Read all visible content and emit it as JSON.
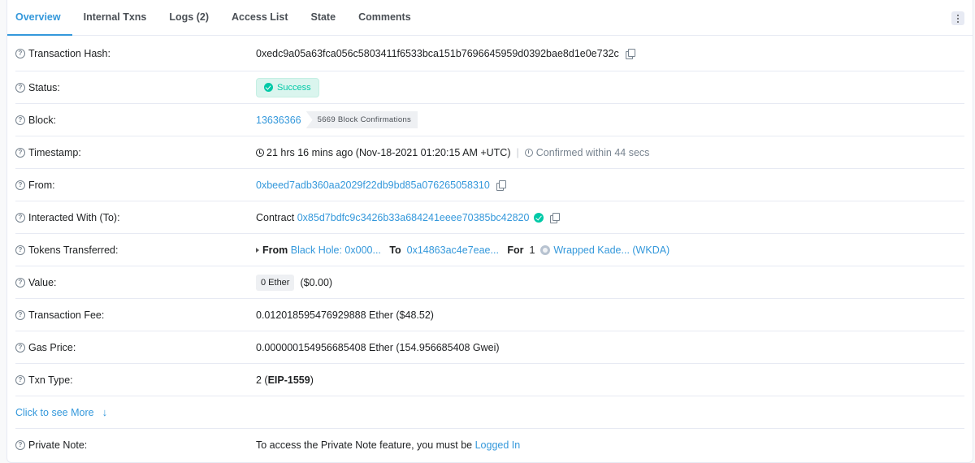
{
  "tabs": [
    {
      "label": "Overview",
      "active": true
    },
    {
      "label": "Internal Txns",
      "active": false
    },
    {
      "label": "Logs (2)",
      "active": false
    },
    {
      "label": "Access List",
      "active": false
    },
    {
      "label": "State",
      "active": false
    },
    {
      "label": "Comments",
      "active": false
    }
  ],
  "tx_hash": {
    "label": "Transaction Hash:",
    "value": "0xedc9a05a63fca056c5803411f6533bca151b7696645959d0392bae8d1e0e732c"
  },
  "status": {
    "label": "Status:",
    "value": "Success"
  },
  "block": {
    "label": "Block:",
    "number": "13636366",
    "confirmations": "5669 Block Confirmations"
  },
  "timestamp": {
    "label": "Timestamp:",
    "value": "21 hrs 16 mins ago (Nov-18-2021 01:20:15 AM +UTC)",
    "confirmed": "Confirmed within 44 secs"
  },
  "from": {
    "label": "From:",
    "value": "0xbeed7adb360aa2029f22db9bd85a076265058310"
  },
  "to": {
    "label": "Interacted With (To):",
    "prefix": "Contract",
    "address": "0x85d7bdfc9c3426b33a684241eeee70385bc42820"
  },
  "tokens": {
    "label": "Tokens Transferred:",
    "from_label": "From",
    "from_value": "Black Hole: 0x000...",
    "to_label": "To",
    "to_value": "0x14863ac4e7eae...",
    "for_label": "For",
    "amount": "1",
    "token": "Wrapped Kade... (WKDA)"
  },
  "value": {
    "label": "Value:",
    "amount": "0 Ether",
    "usd": "($0.00)"
  },
  "fee": {
    "label": "Transaction Fee:",
    "value": "0.012018595476929888 Ether ($48.52)"
  },
  "gas_price": {
    "label": "Gas Price:",
    "value": "0.000000154956685408 Ether (154.956685408 Gwei)"
  },
  "txn_type": {
    "label": "Txn Type:",
    "prefix": "2 (",
    "type": "EIP-1559",
    "suffix": ")"
  },
  "see_more": "Click to see More",
  "private_note": {
    "label": "Private Note:",
    "text": "To access the Private Note feature, you must be",
    "link": "Logged In"
  },
  "colors": {
    "accent": "#3498db",
    "success": "#00c9a7",
    "border": "#e7eaf3"
  }
}
